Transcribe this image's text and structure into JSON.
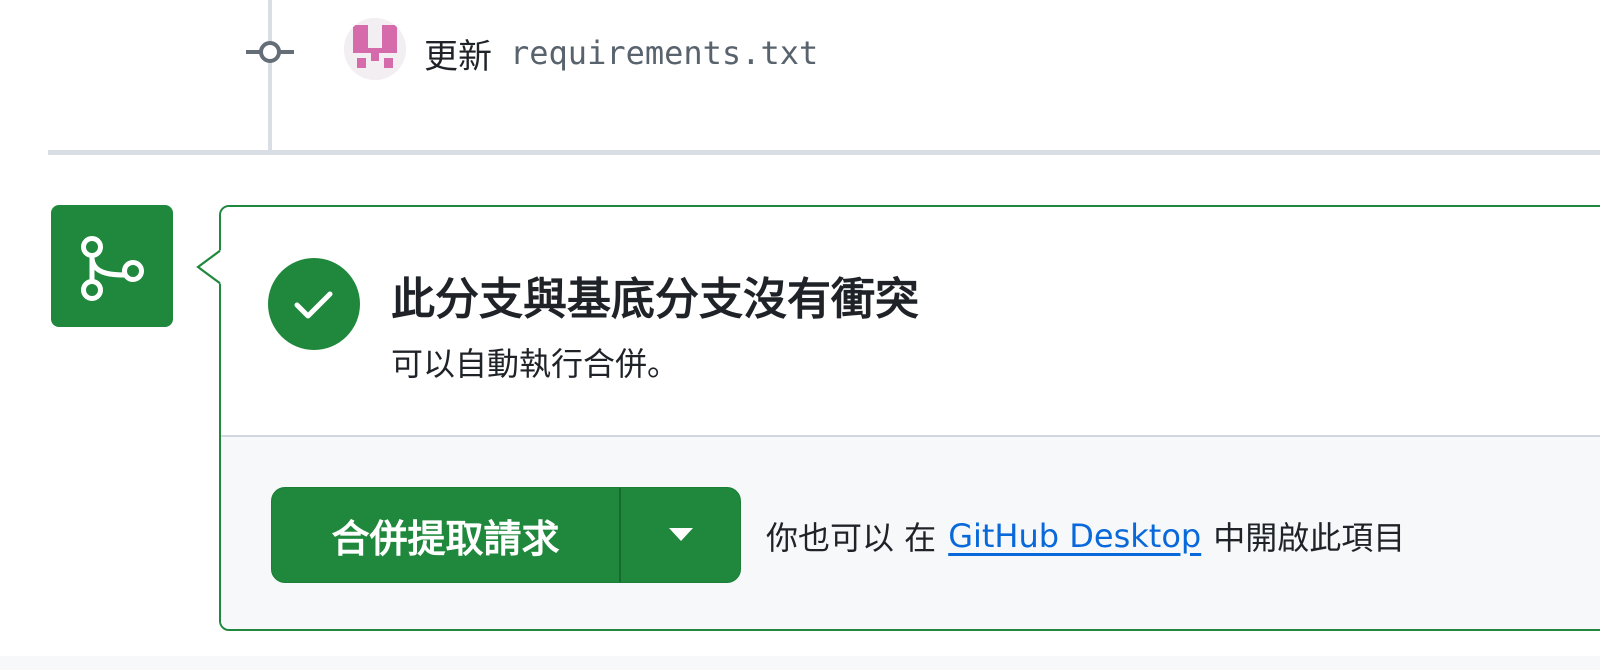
{
  "commit": {
    "verb": "更新",
    "file": "requirements.txt",
    "icons": {
      "commit_dot": "git-commit-icon",
      "avatar": "identicon-avatar"
    }
  },
  "merge_status": {
    "icon": "git-branch-merge-icon",
    "check_icon": "check-icon",
    "title": "此分支與基底分支沒有衝突",
    "subtitle": "可以自動執行合併。"
  },
  "actions": {
    "merge_button_label": "合併提取請求",
    "dropdown_icon": "triangle-down-icon",
    "alt_prefix": "你也可以 在",
    "alt_link": "GitHub Desktop",
    "alt_suffix": "中開啟此項目"
  },
  "colors": {
    "accent_green": "#1f883d",
    "link_blue": "#0969da",
    "avatar_pink": "#d66bac"
  }
}
